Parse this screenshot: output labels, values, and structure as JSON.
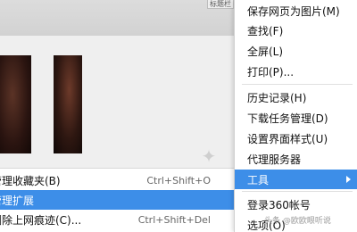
{
  "background": {
    "tab_text": "标题栏"
  },
  "left_menu": {
    "items": [
      {
        "label": "管理收藏夹(B)",
        "shortcut": "Ctrl+Shift+O"
      },
      {
        "label": "管理扩展",
        "shortcut": ""
      },
      {
        "label": "删除上网痕迹(C)...",
        "shortcut": "Ctrl+Shift+Del"
      }
    ],
    "active_index": 1
  },
  "right_menu": {
    "items": [
      "保存网页为图片(M)",
      "查找(F)",
      "全屏(L)",
      "打印(P)...",
      "历史记录(H)",
      "下载任务管理(D)",
      "设置界面样式(U)",
      "代理服务器",
      "工具",
      "登录360帐号",
      "选项(O)"
    ],
    "active_index": 8
  },
  "watermark": "头条 @欧欧眼听说",
  "colors": {
    "highlight": "#3d8ee8",
    "menu_bg": "#ffffff",
    "separator": "#e0e0e0"
  }
}
